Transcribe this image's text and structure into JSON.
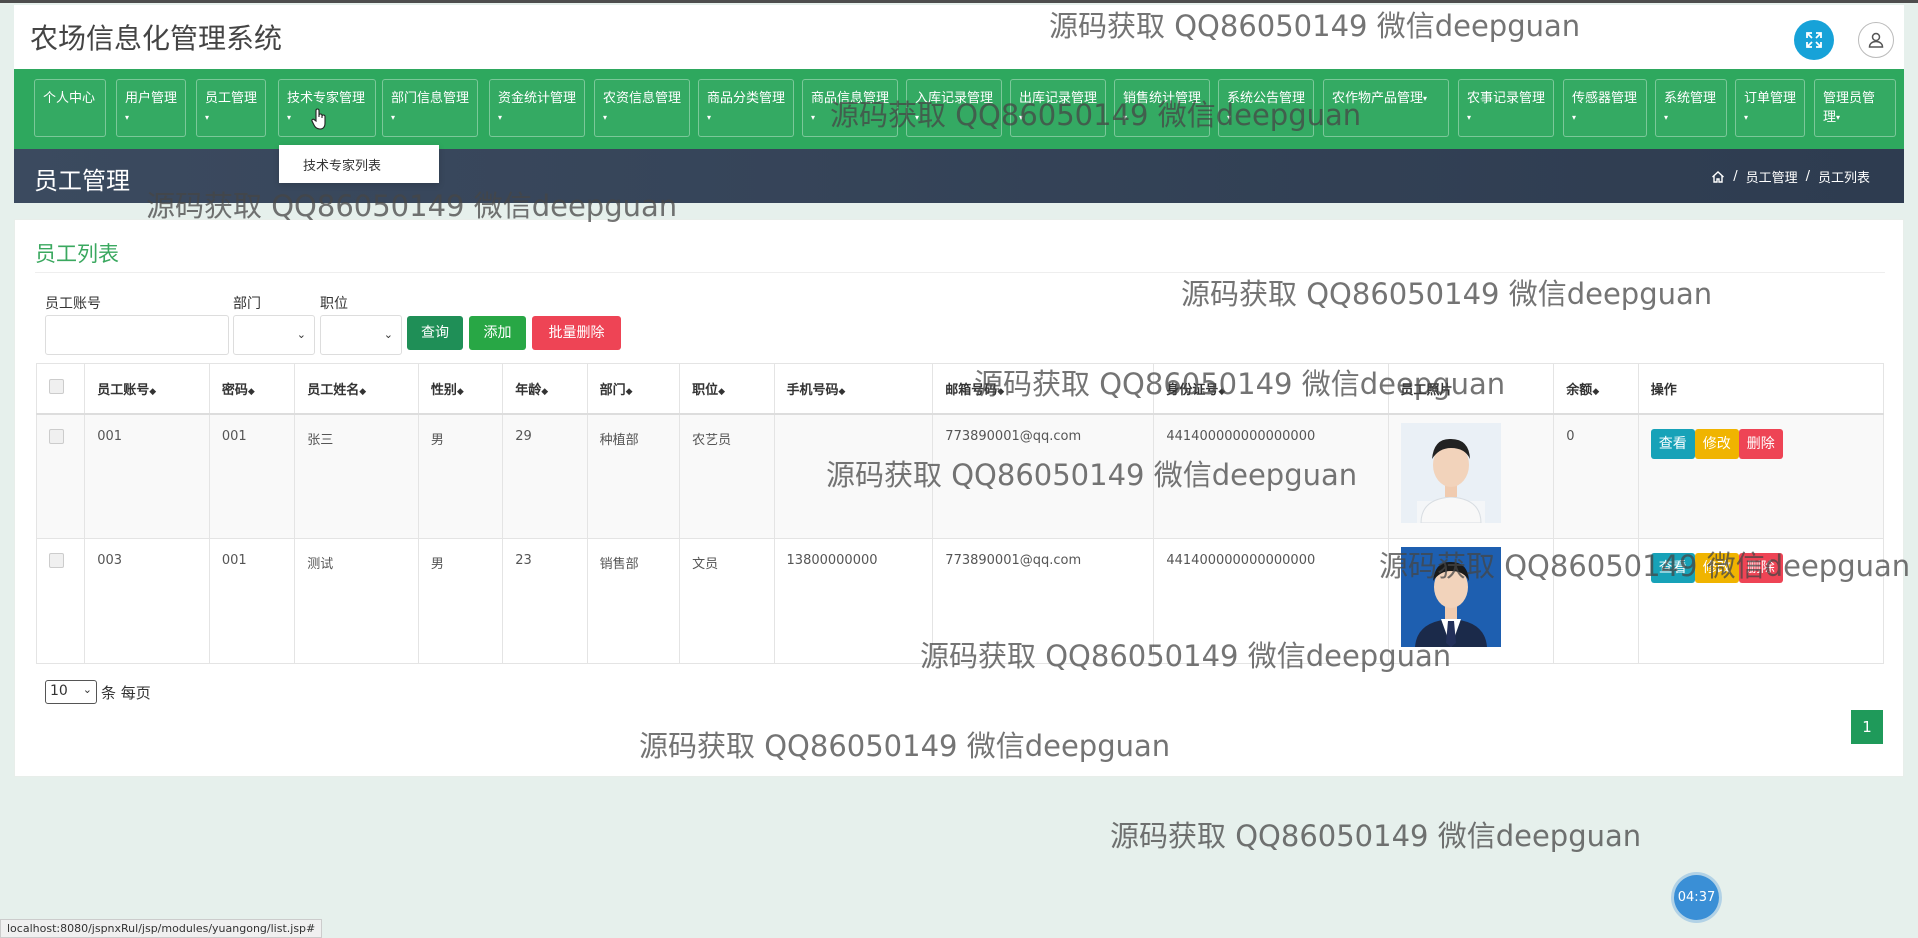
{
  "app": {
    "title": "农场信息化管理系统"
  },
  "nav": {
    "items": [
      {
        "label": "个人中心"
      },
      {
        "label": "用户管理"
      },
      {
        "label": "员工管理"
      },
      {
        "label": "技术专家管理"
      },
      {
        "label": "部门信息管理"
      },
      {
        "label": "资金统计管理"
      },
      {
        "label": "农资信息管理"
      },
      {
        "label": "商品分类管理"
      },
      {
        "label": "商品信息管理"
      },
      {
        "label": "入库记录管理"
      },
      {
        "label": "出库记录管理"
      },
      {
        "label": "销售统计管理"
      },
      {
        "label": "系统公告管理"
      },
      {
        "label": "农作物产品管理"
      },
      {
        "label": "农事记录管理"
      },
      {
        "label": "传感器管理"
      },
      {
        "label": "系统管理"
      },
      {
        "label": "订单管理"
      },
      {
        "label": "管理员管理"
      }
    ],
    "dropdown_item": "技术专家列表"
  },
  "page_header": {
    "title": "员工管理",
    "breadcrumb": [
      "员工管理",
      "员工列表"
    ]
  },
  "panel": {
    "title": "员工列表"
  },
  "filters": {
    "account_label": "员工账号",
    "dept_label": "部门",
    "position_label": "职位",
    "query_button": "查询",
    "add_button": "添加",
    "batch_delete_button": "批量删除"
  },
  "table": {
    "headers": [
      "员工账号",
      "密码",
      "员工姓名",
      "性别",
      "年龄",
      "部门",
      "职位",
      "手机号码",
      "邮箱号码",
      "身份证号",
      "员工照片",
      "余额",
      "操作"
    ],
    "rows": [
      {
        "account": "001",
        "password": "001",
        "name": "张三",
        "gender": "男",
        "age": "29",
        "dept": "种植部",
        "position": "农艺员",
        "phone": "",
        "email": "773890001@qq.com",
        "id_card": "441400000000000000",
        "balance": "0"
      },
      {
        "account": "003",
        "password": "001",
        "name": "测试",
        "gender": "男",
        "age": "23",
        "dept": "销售部",
        "position": "文员",
        "phone": "13800000000",
        "email": "773890001@qq.com",
        "id_card": "441400000000000000",
        "balance": ""
      }
    ],
    "actions": {
      "view": "查看",
      "edit": "修改",
      "delete": "删除"
    }
  },
  "pagination": {
    "page_size": "10",
    "per_page_text": "条 每页",
    "current_page": "1"
  },
  "watermark": "源码获取 QQ86050149 微信deepguan",
  "status_url": "localhost:8080/jspnxRul/jsp/modules/yuangong/list.jsp#",
  "timer": "04:37",
  "colors": {
    "nav_green": "#2ea85e",
    "header_dark": "#3b4a5f",
    "view_btn": "#17a2b8",
    "edit_btn": "#f0b400",
    "delete_btn": "#ee4455"
  }
}
